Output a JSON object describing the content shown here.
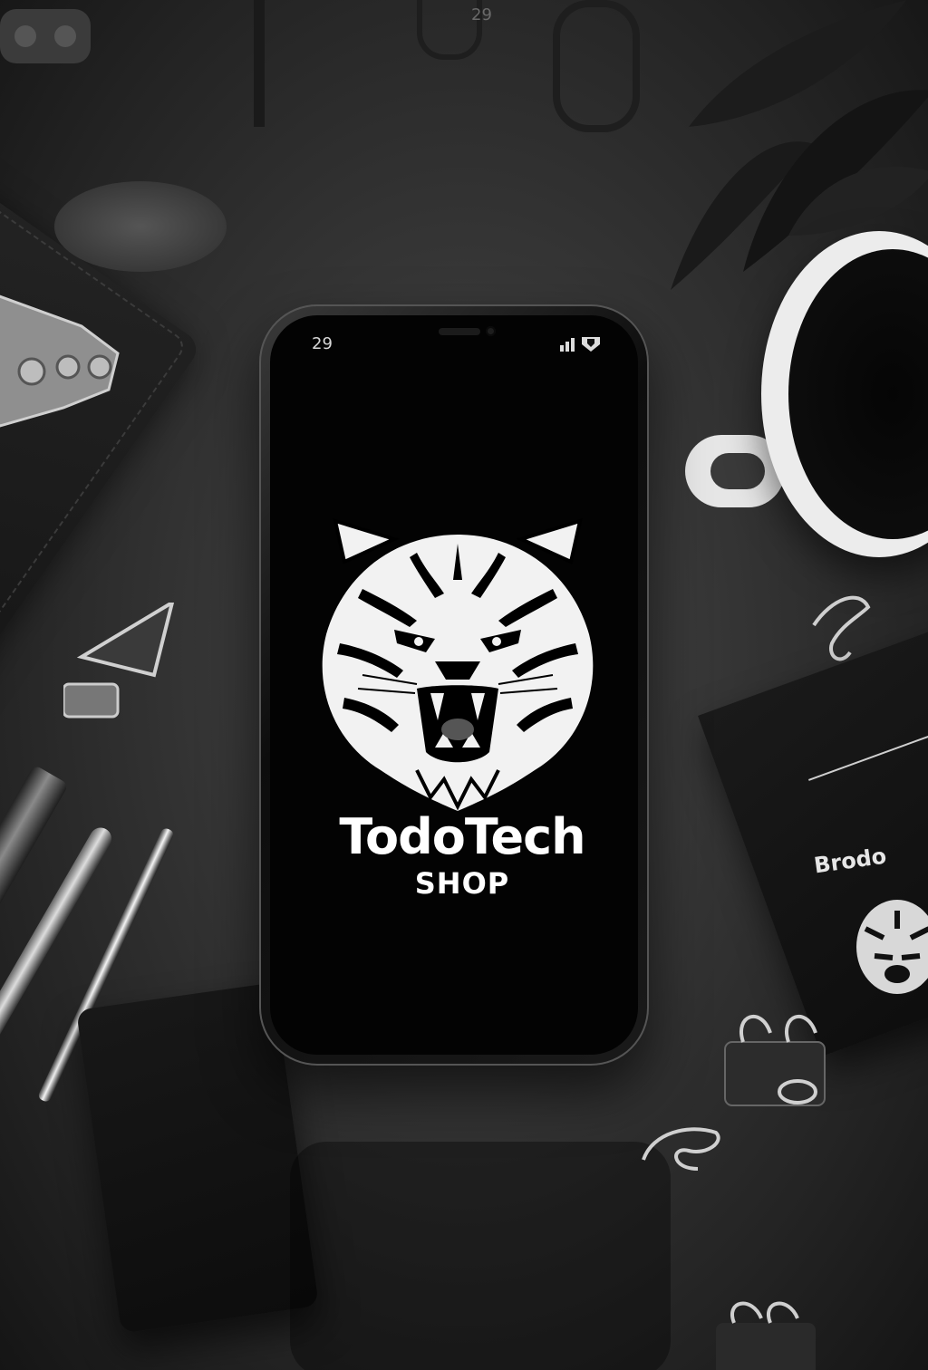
{
  "background": {
    "color": "#2e2e2e"
  },
  "top_number": "29",
  "phone": {
    "status_time": "29",
    "signal_icon": "signal-icon",
    "screen_color": "#030303",
    "logo_icon": "tiger-head-icon",
    "brand_title": "TodoTech",
    "brand_subtitle": "SHOP"
  },
  "notebook": {
    "label": "Brodo",
    "emblem_icon": "tiger-head-icon"
  }
}
